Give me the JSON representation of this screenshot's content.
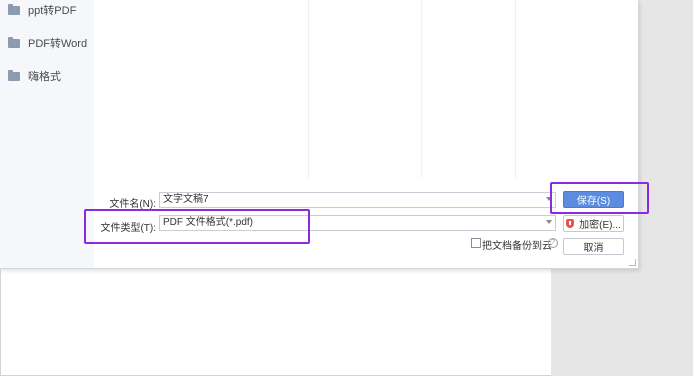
{
  "sidebar": {
    "items": [
      {
        "label": "ppt转PDF",
        "icon": "folder-icon"
      },
      {
        "label": "PDF转Word",
        "icon": "folder-icon"
      },
      {
        "label": "嗨格式",
        "icon": "folder-icon"
      }
    ]
  },
  "form": {
    "filename_label": "文件名(N):",
    "filename_value": "文字文稿7",
    "filetype_label": "文件类型(T):",
    "filetype_value": "PDF 文件格式(*.pdf)",
    "backup_label": "把文档备份到云",
    "help_glyph": "?"
  },
  "buttons": {
    "save": "保存(S)",
    "encrypt": "加密(E)...",
    "cancel": "取消"
  },
  "colors": {
    "highlight": "#8a2be2",
    "primary": "#5b8ce0"
  }
}
